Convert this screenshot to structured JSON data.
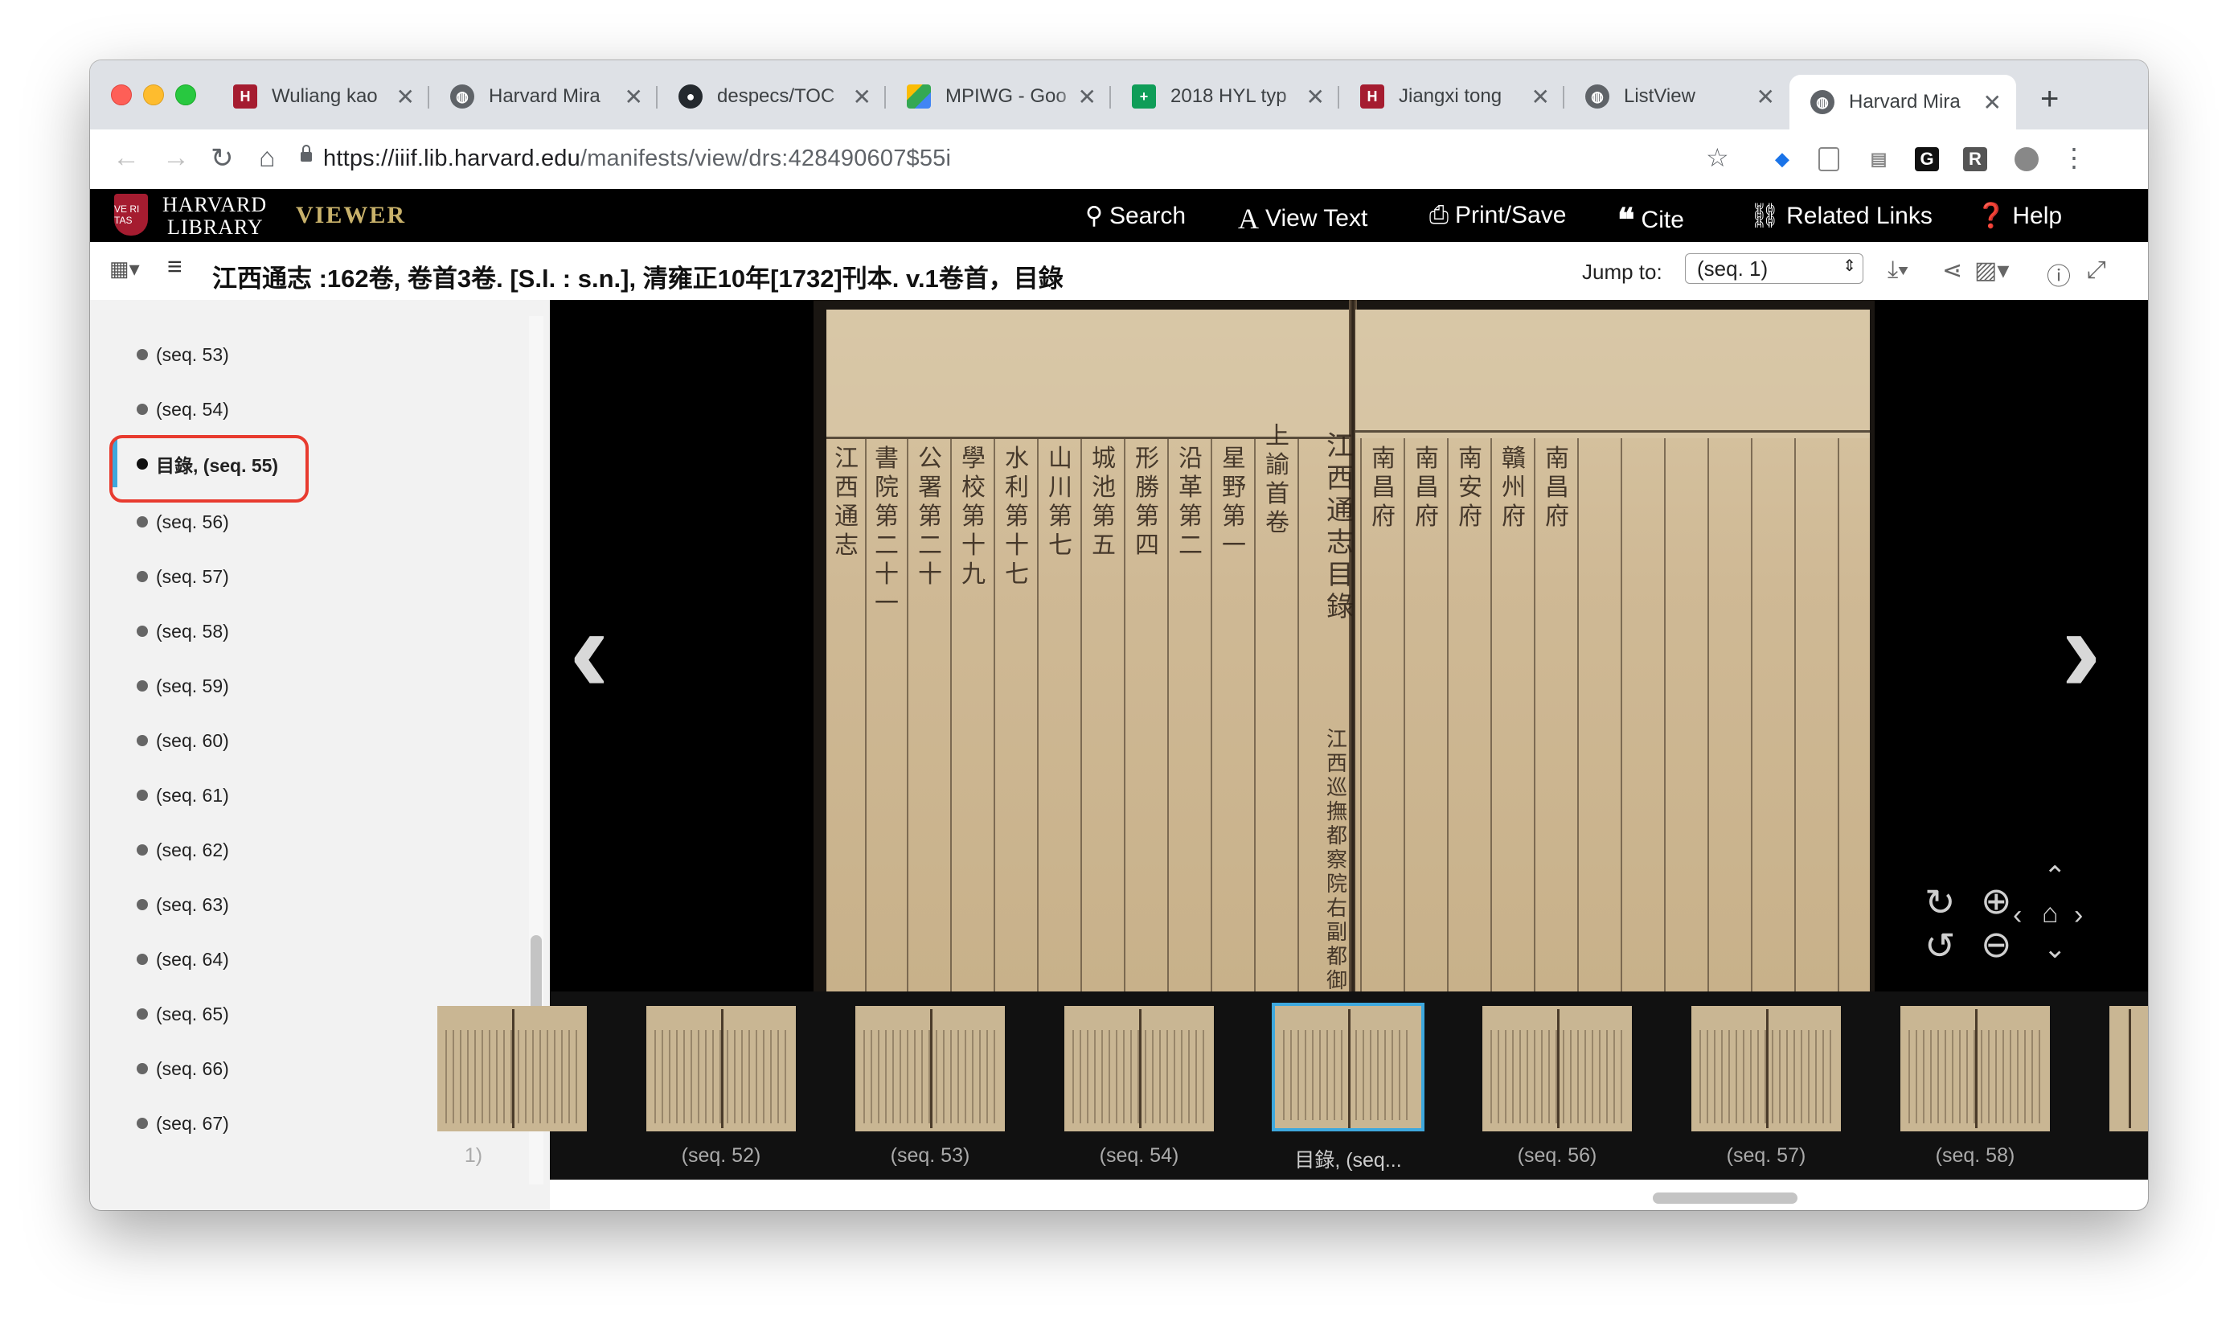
{
  "browser": {
    "tabs": [
      {
        "label": "Wuliang kao",
        "icon": "harvard-shield-icon"
      },
      {
        "label": "Harvard Mira",
        "icon": "globe-icon"
      },
      {
        "label": "despecs/TOC",
        "icon": "github-icon"
      },
      {
        "label": "MPIWG - Goo",
        "icon": "google-drive-icon"
      },
      {
        "label": "2018 HYL typ",
        "icon": "google-sheets-icon"
      },
      {
        "label": "Jiangxi tong",
        "icon": "harvard-shield-icon"
      },
      {
        "label": "ListView",
        "icon": "globe-icon"
      },
      {
        "label": "Harvard Mira",
        "icon": "globe-icon"
      }
    ],
    "url_host": "https://iiif.lib.harvard.edu",
    "url_path": "/manifests/view/drs:428490607$55i"
  },
  "site": {
    "logo_line1": "HARVARD",
    "logo_line2": "LIBRARY",
    "viewer_label": "VIEWER",
    "menu": {
      "search": "Search",
      "view_text": "View Text",
      "print_save": "Print/Save",
      "cite": "Cite",
      "related_links": "Related Links",
      "help": "Help"
    }
  },
  "viewer": {
    "title": "江西通志 :162卷, 卷首3卷. [S.l. : s.n.], 清雍正10年[1732]刊本. v.1卷首，目錄",
    "jump_label": "Jump to:",
    "jump_value": "(seq. 1)"
  },
  "sidebar": {
    "items": [
      {
        "label": "(seq. 53)"
      },
      {
        "label": "(seq. 54)"
      },
      {
        "label": "目錄, (seq. 55)",
        "selected": true
      },
      {
        "label": "(seq. 56)"
      },
      {
        "label": "(seq. 57)"
      },
      {
        "label": "(seq. 58)"
      },
      {
        "label": "(seq. 59)"
      },
      {
        "label": "(seq. 60)"
      },
      {
        "label": "(seq. 61)"
      },
      {
        "label": "(seq. 62)"
      },
      {
        "label": "(seq. 63)"
      },
      {
        "label": "(seq. 64)"
      },
      {
        "label": "(seq. 65)"
      },
      {
        "label": "(seq. 66)"
      },
      {
        "label": "(seq. 67)"
      }
    ]
  },
  "page_text": {
    "left_columns": [
      "江西通志",
      "書院第二十一",
      "公署第二十",
      "學校第十九",
      "水利第十七",
      "山川第七",
      "城池第五",
      "形勝第四",
      "沿革第二",
      "星野第一",
      "上諭首卷"
    ],
    "right_columns": [
      "江西通志目錄",
      "江西巡撫都察院右副都御史",
      "南昌府",
      "南昌府",
      "南安府",
      "贛州府",
      "南昌府"
    ]
  },
  "filmstrip": {
    "items": [
      {
        "label": "1)"
      },
      {
        "label": "(seq. 52)"
      },
      {
        "label": "(seq. 53)"
      },
      {
        "label": "(seq. 54)"
      },
      {
        "label": "目錄, (seq...",
        "selected": true
      },
      {
        "label": "(seq. 56)"
      },
      {
        "label": "(seq. 57)"
      },
      {
        "label": "(seq. 58)"
      }
    ]
  },
  "colors": {
    "accent": "#3ea8dd",
    "highlight_box": "#e83b2f",
    "viewer_gold": "#c9b26b",
    "harvard_crimson": "#a51c30"
  }
}
